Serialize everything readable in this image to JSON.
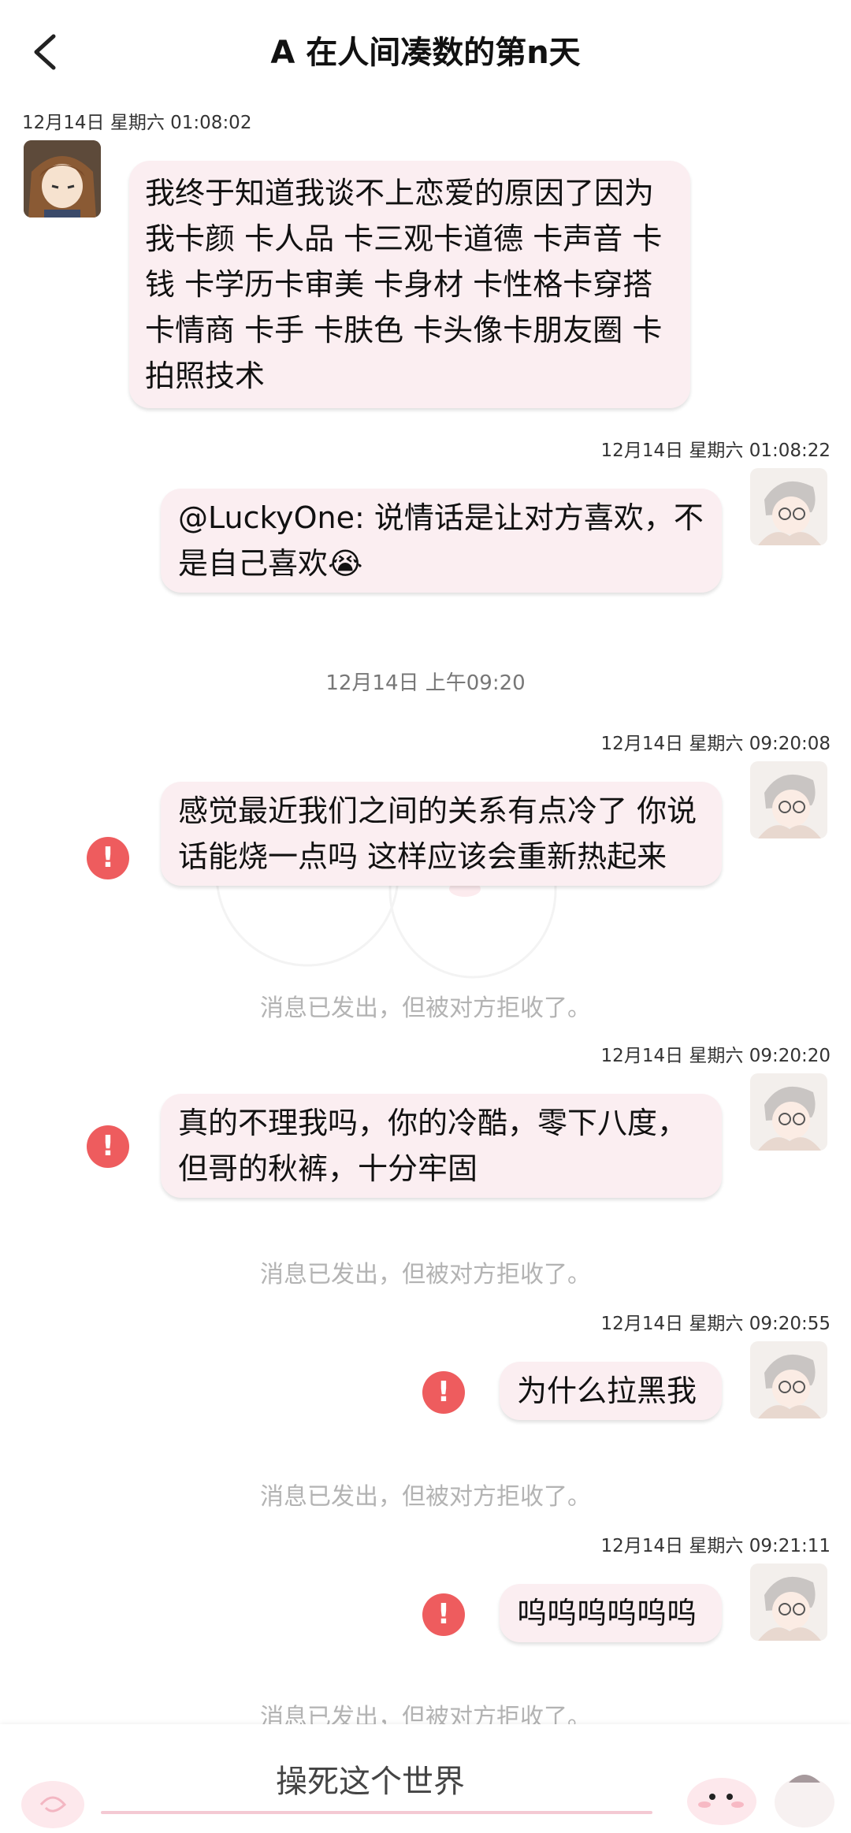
{
  "header": {
    "title": "A 在人间凑数的第n天"
  },
  "messages": [
    {
      "timestamp": "12月14日 星期六 01:08:02",
      "text": "我终于知道我谈不上恋爱的原因了因为我卡颜 卡人品 卡三观卡道德 卡声音 卡钱 卡学历卡审美 卡身材 卡性格卡穿搭卡情商 卡手 卡肤色 卡头像卡朋友圈 卡拍照技术"
    },
    {
      "timestamp": "12月14日 星期六 01:08:22",
      "text": "@LuckyOne: 说情话是让对方喜欢，不是自己喜欢😭"
    },
    {
      "timestamp": "12月14日 星期六 09:20:08",
      "text": "感觉最近我们之间的关系有点冷了 你说话能烧一点吗  这样应该会重新热起来",
      "note": "消息已发出，但被对方拒收了。"
    },
    {
      "timestamp": "12月14日 星期六 09:20:20",
      "text": "真的不理我吗，你的冷酷，零下八度，但哥的秋裤，十分牢固",
      "note": "消息已发出，但被对方拒收了。"
    },
    {
      "timestamp": "12月14日 星期六 09:20:55",
      "text": "为什么拉黑我",
      "note": "消息已发出，但被对方拒收了。"
    },
    {
      "timestamp": "12月14日 星期六 09:21:11",
      "text": "呜呜呜呜呜呜",
      "note": "消息已发出，但被对方拒收了。"
    }
  ],
  "center_time": "12月14日 上午09:20",
  "error_mark": "!",
  "input": {
    "text": "操死这个世界"
  },
  "colors": {
    "bubble": "#fbeef1",
    "error": "#ee5c5e",
    "accent": "#f4c9d3"
  }
}
